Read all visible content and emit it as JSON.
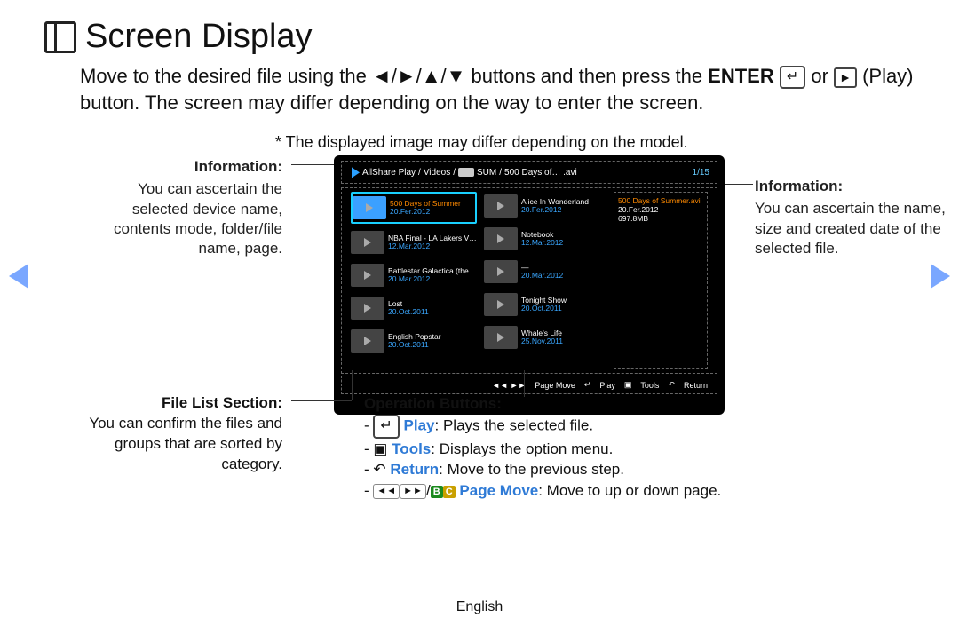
{
  "title": "Screen Display",
  "para_lead": "Move to the desired file using the ",
  "para_arrows": "◄/►/▲/▼",
  "para_after": " buttons and then press the ",
  "para_enter": "ENTER",
  "para_or": " or ",
  "para_play": "∂",
  "para_tail": " (Play) button. The screen may differ depending on the way to enter the screen.",
  "note": "* The displayed image may differ depending on the model.",
  "left_info": {
    "head": "Information:",
    "body": "You can ascertain the selected device name, contents mode, folder/file name, page."
  },
  "right_info": {
    "head": "Information:",
    "body": "You can ascertain the name, size and created date of the selected file."
  },
  "file_list": {
    "head": "File List Section:",
    "body": "You can confirm the files and groups that are sorted by category."
  },
  "ops_head": "Operation Buttons:",
  "op_play_k": "Play",
  "op_play_t": ": Plays the selected file.",
  "op_tools_k": "Tools",
  "op_tools_t": ": Displays the option menu.",
  "op_return_k": "Return",
  "op_return_t": ": Move to the previous step.",
  "op_page_k": "Page Move",
  "op_page_t": ": Move to up or down page.",
  "tv": {
    "crumb_app": "AllShare Play",
    "crumb_sec": "Videos",
    "crumb_dev": "SUM",
    "crumb_file": "500 Days of… .avi",
    "page": "1/15",
    "colA": [
      {
        "t": "500 Days of Summer",
        "d": "20.Fer.2012",
        "sel": true
      },
      {
        "t": "NBA Final - LA Lakers VS...",
        "d": "12.Mar.2012"
      },
      {
        "t": "Battlestar Galactica (the...",
        "d": "20.Mar.2012"
      },
      {
        "t": "Lost",
        "d": "20.Oct.2011"
      },
      {
        "t": "English Popstar",
        "d": "20.Oct.2011"
      }
    ],
    "colB": [
      {
        "t": "Alice In Wonderland",
        "d": "20.Fer.2012"
      },
      {
        "t": "Notebook",
        "d": "12.Mar.2012"
      },
      {
        "t": "—",
        "d": "20.Mar.2012"
      },
      {
        "t": "Tonight Show",
        "d": "20.Oct.2011"
      },
      {
        "t": "Whale's Life",
        "d": "25.Nov.2011"
      }
    ],
    "info": {
      "t": "500 Days of Summer.avi",
      "d": "20.Fer.2012",
      "s": "697.8MB"
    },
    "ops": {
      "pm": "Page Move",
      "pl": "Play",
      "to": "Tools",
      "re": "Return"
    }
  },
  "footer": "English"
}
